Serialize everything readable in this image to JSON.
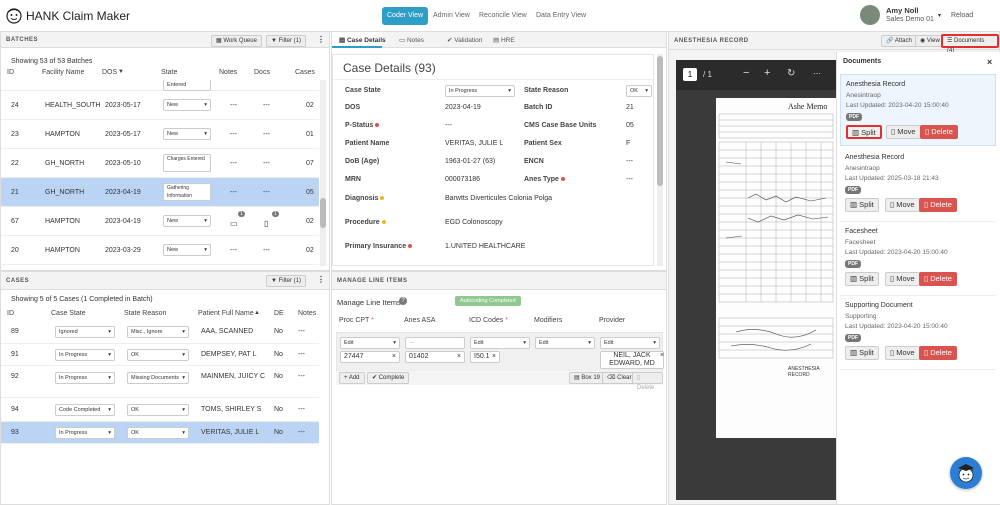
{
  "app": {
    "title": "HANK Claim Maker",
    "nav": [
      "Coder View",
      "Admin View",
      "Reconcile View",
      "Data Entry View"
    ],
    "user_name": "Amy Noll",
    "user_role": "Sales Demo 01",
    "reload": "Reload"
  },
  "batches": {
    "header": "BATCHES",
    "work_queue": "Work Queue",
    "filter": "Filter (1)",
    "showing": "Showing 53 of 53 Batches",
    "columns": [
      "ID",
      "Facility Name",
      "DOS",
      "State",
      "Notes",
      "Docs",
      "Cases"
    ],
    "rows": [
      {
        "id": "",
        "facility": "",
        "dos": "",
        "state": "Entered",
        "notes": "",
        "docs": "",
        "cases": ""
      },
      {
        "id": "24",
        "facility": "HEALTH_SOUTH",
        "dos": "2023-05-17",
        "state": "New",
        "notes": "---",
        "docs": "---",
        "cases": "02"
      },
      {
        "id": "23",
        "facility": "HAMPTON",
        "dos": "2023-05-17",
        "state": "New",
        "notes": "---",
        "docs": "---",
        "cases": "01"
      },
      {
        "id": "22",
        "facility": "GH_NORTH",
        "dos": "2023-05-10",
        "state": "Charges Entered",
        "notes": "---",
        "docs": "---",
        "cases": "07"
      },
      {
        "id": "21",
        "facility": "GH_NORTH",
        "dos": "2023-04-19",
        "state": "Gathering Information",
        "notes": "---",
        "docs": "---",
        "cases": "05"
      },
      {
        "id": "67",
        "facility": "HAMPTON",
        "dos": "2023-04-19",
        "state": "New",
        "notes": "1",
        "docs": "1",
        "cases": "02"
      },
      {
        "id": "20",
        "facility": "HAMPTON",
        "dos": "2023-03-29",
        "state": "New",
        "notes": "---",
        "docs": "---",
        "cases": "02"
      }
    ]
  },
  "cases": {
    "header": "CASES",
    "filter": "Filter (1)",
    "showing": "Showing 5 of 5 Cases (1 Completed in Batch)",
    "columns": [
      "ID",
      "Case State",
      "State Reason",
      "Patient Full Name",
      "DE",
      "Notes"
    ],
    "rows": [
      {
        "id": "89",
        "state": "Ignored",
        "reason": "Misc., Ignore",
        "name": "AAA, SCANNED",
        "de": "No",
        "notes": "---"
      },
      {
        "id": "91",
        "state": "In Progress",
        "reason": "OK",
        "name": "DEMPSEY, PAT L",
        "de": "No",
        "notes": "---"
      },
      {
        "id": "92",
        "state": "In Progress",
        "reason": "Missing Documents",
        "name": "MAINMEN, JUICY C",
        "de": "No",
        "notes": "---"
      },
      {
        "id": "94",
        "state": "Code Completed",
        "reason": "OK",
        "name": "TOMS, SHIRLEY S",
        "de": "No",
        "notes": "---"
      },
      {
        "id": "93",
        "state": "In Progress",
        "reason": "OK",
        "name": "VERITAS, JULIE L",
        "de": "No",
        "notes": "---"
      }
    ]
  },
  "case_details": {
    "tabs": [
      "Case Details",
      "Notes",
      "Validation",
      "HRE"
    ],
    "title": "Case Details (93)",
    "case_state_label": "Case State",
    "case_state": "In Progress",
    "state_reason_label": "State Reason",
    "state_reason": "OK",
    "fields": [
      {
        "l1": "DOS",
        "v1": "2023-04-19",
        "l2": "Batch ID",
        "v2": "21"
      },
      {
        "l1": "P-Status",
        "v1": "---",
        "l2": "CMS Case Base Units",
        "v2": "05"
      },
      {
        "l1": "Patient Name",
        "v1": "VERITAS, JULIE L",
        "l2": "Patient Sex",
        "v2": "F"
      },
      {
        "l1": "DoB (Age)",
        "v1": "1963-01-27 (63)",
        "l2": "ENCN",
        "v2": "---"
      },
      {
        "l1": "MRN",
        "v1": "000073186",
        "l2": "Anes Type",
        "v2": "---"
      }
    ],
    "diagnosis_label": "Diagnosis",
    "diagnosis": "Barwtts Diverticules Colonia Polga",
    "procedure_label": "Procedure",
    "procedure": "EGD Colonoscopy",
    "insurance_label": "Primary Insurance",
    "insurance": "1.UNITED HEALTHCARE"
  },
  "line_items": {
    "header": "MANAGE LINE ITEMS",
    "label": "Manage Line Items",
    "autocoding": "Autocoding Completed",
    "columns": [
      "Proc CPT",
      "Anes ASA",
      "ICD Codes",
      "Modifiers",
      "Provider"
    ],
    "edit": "Edit",
    "asa_placeholder": "---",
    "cpt": "27447",
    "asa": "01402",
    "icd": "I50.1",
    "provider": "NEIL, JACK EDWARD, MD",
    "add": "+ Add",
    "complete": "Complete",
    "box19": "Box 19",
    "clear": "Clear",
    "delete": "Delete"
  },
  "viewer": {
    "header": "ANESTHESIA RECORD",
    "attach": "Attach",
    "view": "View",
    "documents_btn": "Documents (4)",
    "page": "1",
    "pages": "/ 1",
    "doc_text": "ANESTHESIA RECORD",
    "doc_brand": "Ashe Memo"
  },
  "documents": {
    "title": "Documents",
    "items": [
      {
        "title": "Anesthesia Record",
        "sub": "Anesintraop",
        "updated": "Last Updated: 2023-04-20 15:00:40"
      },
      {
        "title": "Anesthesia Record",
        "sub": "Anesintraop",
        "updated": "Last Updated: 2025-03-18 21:43"
      },
      {
        "title": "Facesheet",
        "sub": "Facesheet",
        "updated": "Last Updated: 2023-04-20 15:00:40"
      },
      {
        "title": "Supporting Document",
        "sub": "Supporting",
        "updated": "Last Updated: 2023-04-20 15:00:40"
      }
    ],
    "pdf": "PDF",
    "split": "Split",
    "move": "Move",
    "delete": "Delete"
  },
  "colors": {
    "accent": "#2e9ec7",
    "selected": "#bcd4f4",
    "danger": "#d9534f",
    "highlight": "#e03030"
  }
}
